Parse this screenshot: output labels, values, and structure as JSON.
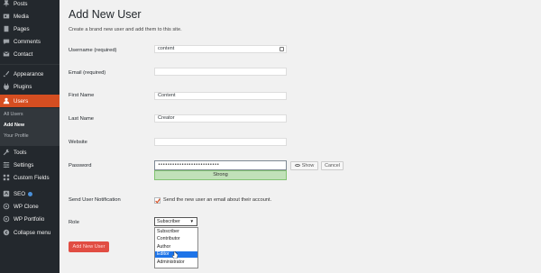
{
  "sidebar": {
    "items": [
      {
        "label": "Posts",
        "icon": "pin-icon"
      },
      {
        "label": "Media",
        "icon": "media-icon"
      },
      {
        "label": "Pages",
        "icon": "pages-icon"
      },
      {
        "label": "Comments",
        "icon": "comment-icon"
      },
      {
        "label": "Contact",
        "icon": "mail-icon"
      },
      {
        "label": "Appearance",
        "icon": "brush-icon"
      },
      {
        "label": "Plugins",
        "icon": "plug-icon"
      },
      {
        "label": "Users",
        "icon": "users-icon",
        "active": true
      },
      {
        "label": "Tools",
        "icon": "wrench-icon"
      },
      {
        "label": "Settings",
        "icon": "settings-icon"
      },
      {
        "label": "Custom Fields",
        "icon": "grid-icon"
      },
      {
        "label": "SEO",
        "icon": "seo-icon"
      },
      {
        "label": "WP Clone",
        "icon": "clone-icon"
      },
      {
        "label": "WP Portfolio",
        "icon": "portfolio-icon"
      },
      {
        "label": "Collapse menu",
        "icon": "collapse-icon"
      }
    ],
    "users_submenu": [
      "All Users",
      "Add New",
      "Your Profile"
    ]
  },
  "page": {
    "title": "Add New User",
    "description": "Create a brand new user and add them to this site."
  },
  "form": {
    "username_label": "Username (required)",
    "username_value": "content",
    "email_label": "Email (required)",
    "email_value": "",
    "first_name_label": "First Name",
    "first_name_value": "Content",
    "last_name_label": "Last Name",
    "last_name_value": "Creator",
    "website_label": "Website",
    "website_value": "",
    "password_label": "Password",
    "password_value": "••••••••••••••••••••••••••",
    "password_strength": "Strong",
    "show_button": "Show",
    "cancel_button": "Cancel",
    "notification_label": "Send User Notification",
    "notification_text": "Send the new user an email about their account.",
    "notification_checked": true,
    "role_label": "Role",
    "role_selected": "Subscriber",
    "role_options": [
      "Subscriber",
      "Contributor",
      "Author",
      "Editor",
      "Administrator"
    ],
    "role_highlighted": "Editor",
    "submit_button": "Add New User"
  },
  "colors": {
    "sidebar_bg": "#23282d",
    "active_item": "#d54e21",
    "strength_bg": "#c1e1b9",
    "primary_button": "#e14d43",
    "highlight": "#1e74e8"
  }
}
